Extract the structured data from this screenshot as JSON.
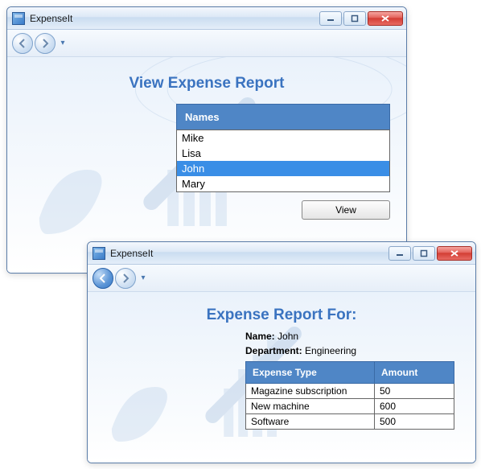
{
  "win1": {
    "title": "ExpenseIt",
    "page_title": "View Expense Report",
    "names_header": "Names",
    "names": [
      "Mike",
      "Lisa",
      "John",
      "Mary"
    ],
    "selected_index": 2,
    "view_button": "View"
  },
  "win2": {
    "title": "ExpenseIt",
    "page_title": "Expense Report For:",
    "name_label": "Name:",
    "name_value": "John",
    "dept_label": "Department:",
    "dept_value": "Engineering",
    "col_type": "Expense Type",
    "col_amount": "Amount",
    "rows": [
      {
        "type": "Magazine subscription",
        "amount": "50"
      },
      {
        "type": "New machine",
        "amount": "600"
      },
      {
        "type": "Software",
        "amount": "500"
      }
    ]
  }
}
